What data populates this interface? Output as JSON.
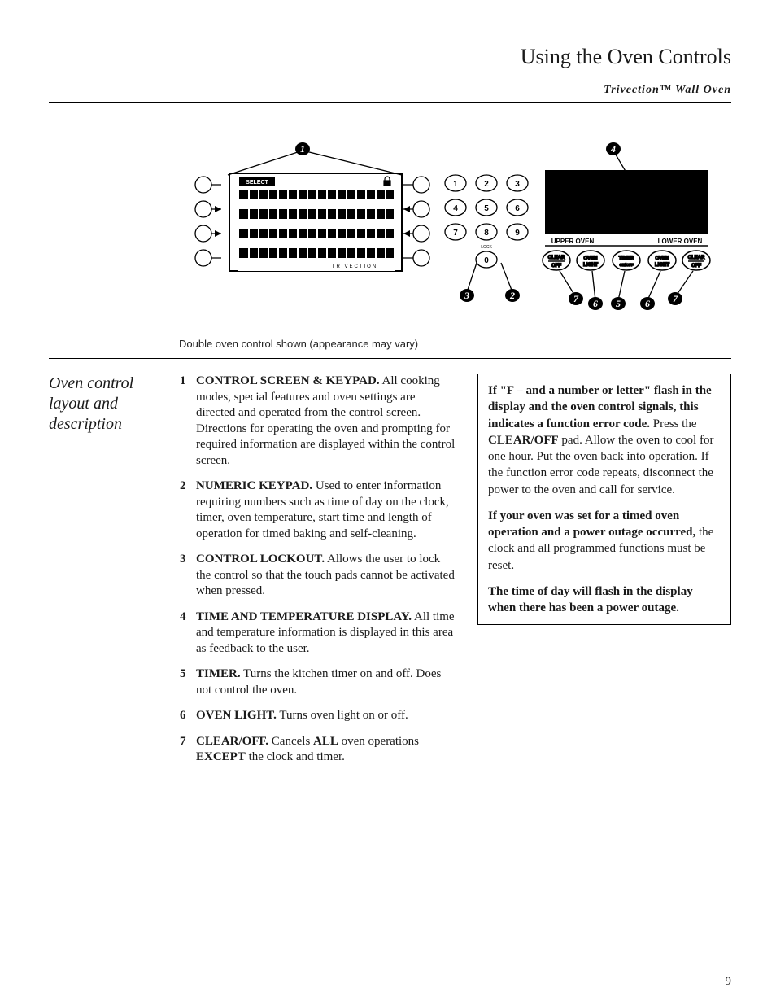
{
  "header": {
    "title": "Using the Oven Controls",
    "product": "Trivection™ Wall Oven"
  },
  "diagram": {
    "caption": "Double oven control shown (appearance may vary)",
    "select_label": "SELECT",
    "brand": "TRIVECTION",
    "lock_label": "LOCK",
    "keypad": [
      "1",
      "2",
      "3",
      "4",
      "5",
      "6",
      "7",
      "8",
      "9",
      "0"
    ],
    "upper_label": "UPPER OVEN",
    "lower_label": "LOWER OVEN",
    "lower_buttons": [
      {
        "line1": "CLEAR",
        "line2": "OFF"
      },
      {
        "line1": "OVEN",
        "line2": "LIGHT"
      },
      {
        "line1": "TIMER",
        "line2": "ON/OFF"
      },
      {
        "line1": "OVEN",
        "line2": "LIGHT"
      },
      {
        "line1": "CLEAR",
        "line2": "OFF"
      }
    ],
    "callouts": [
      "1",
      "2",
      "3",
      "4",
      "5",
      "6",
      "7"
    ]
  },
  "sections": {
    "side_heading": "Oven control layout and description",
    "items": [
      {
        "lead": "CONTROL SCREEN & KEYPAD.",
        "body": " All cooking modes, special features and oven settings are directed and operated from the control screen. Directions for operating the oven and prompting for required information are displayed within the control screen."
      },
      {
        "lead": "NUMERIC KEYPAD.",
        "body": " Used to enter information requiring numbers such as time of day on the clock, timer, oven temperature, start time and length of operation for timed baking and self-cleaning."
      },
      {
        "lead": "CONTROL LOCKOUT.",
        "body": " Allows the user to lock the control so that the touch pads cannot be activated when pressed."
      },
      {
        "lead": "TIME AND TEMPERATURE DISPLAY.",
        "body": " All time and temperature information is displayed in this area as feedback to the user."
      },
      {
        "lead": "TIMER.",
        "body": " Turns the kitchen timer on and off. Does not control the oven."
      },
      {
        "lead": "OVEN LIGHT.",
        "body": " Turns oven light on or off."
      },
      {
        "lead": "CLEAR/OFF.",
        "body_html": " Cancels <b>ALL</b> oven operations <b>EXCEPT</b> the clock and timer."
      }
    ]
  },
  "notice": {
    "p1_lead": "If \"F – and a number or letter\" flash in the display and the oven control signals, this indicates a function error code.",
    "p1_rest": " Press the ",
    "p1_bold": "CLEAR/OFF",
    "p1_tail": " pad. Allow the oven to cool for one hour. Put the oven back into operation. If the function error code repeats, disconnect the power to the oven and call for service.",
    "p2_lead": "If your oven was set for a timed oven operation and a power outage occurred,",
    "p2_rest": " the clock and all programmed functions must be reset.",
    "p3": "The time of day will flash in the display when there has been a power outage."
  },
  "page": "9"
}
